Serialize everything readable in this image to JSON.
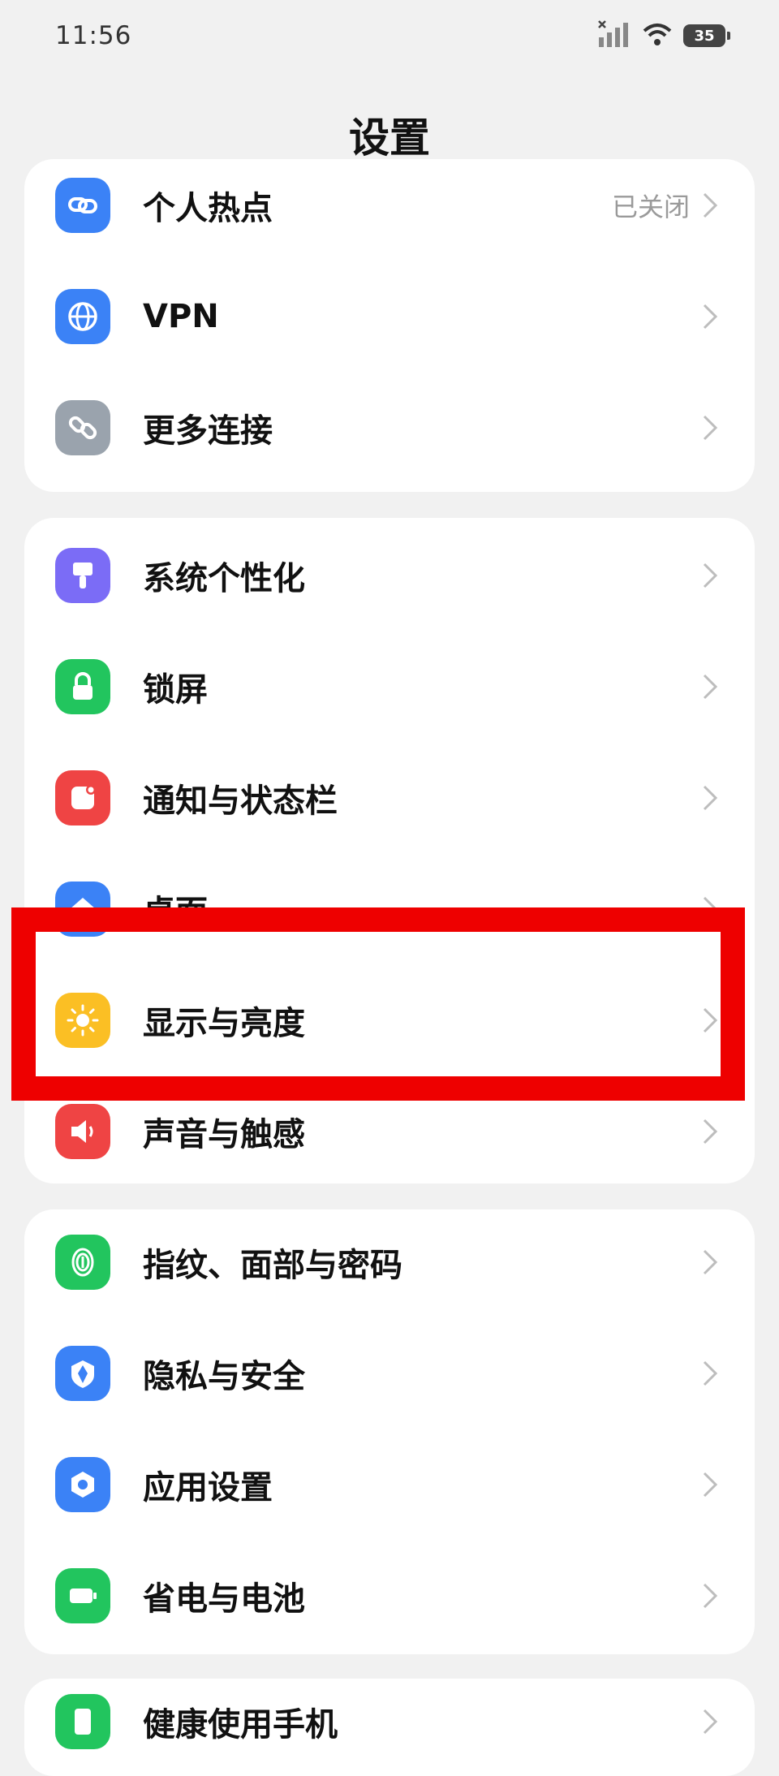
{
  "status": {
    "time": "11:56",
    "battery": "35"
  },
  "header": {
    "title": "设置"
  },
  "groups": [
    {
      "items": [
        {
          "label": "个人热点",
          "value": "已关闭",
          "icon": "hotspot-icon",
          "color": "#3b82f6"
        },
        {
          "label": "VPN",
          "icon": "globe-icon",
          "color": "#3b82f6"
        },
        {
          "label": "更多连接",
          "icon": "link-icon",
          "color": "#9aa3ad"
        }
      ]
    },
    {
      "items": [
        {
          "label": "系统个性化",
          "icon": "brush-icon",
          "color": "#7b6cf6"
        },
        {
          "label": "锁屏",
          "icon": "lock-icon",
          "color": "#22c55e"
        },
        {
          "label": "通知与状态栏",
          "icon": "notification-icon",
          "color": "#ef4444"
        },
        {
          "label": "桌面",
          "icon": "home-icon",
          "color": "#3b82f6"
        },
        {
          "label": "显示与亮度",
          "icon": "sun-icon",
          "color": "#fbbf24"
        },
        {
          "label": "声音与触感",
          "icon": "speaker-icon",
          "color": "#ef4444"
        }
      ]
    },
    {
      "items": [
        {
          "label": "指纹、面部与密码",
          "icon": "fingerprint-icon",
          "color": "#22c55e"
        },
        {
          "label": "隐私与安全",
          "icon": "shield-icon",
          "color": "#3b82f6"
        },
        {
          "label": "应用设置",
          "icon": "hexagon-icon",
          "color": "#3b82f6"
        },
        {
          "label": "省电与电池",
          "icon": "battery-icon",
          "color": "#22c55e"
        }
      ]
    },
    {
      "items": [
        {
          "label": "健康使用手机",
          "icon": "hourglass-icon",
          "color": "#22c55e"
        }
      ]
    }
  ],
  "highlight": {
    "target": "显示与亮度",
    "color": "#ee0000"
  }
}
